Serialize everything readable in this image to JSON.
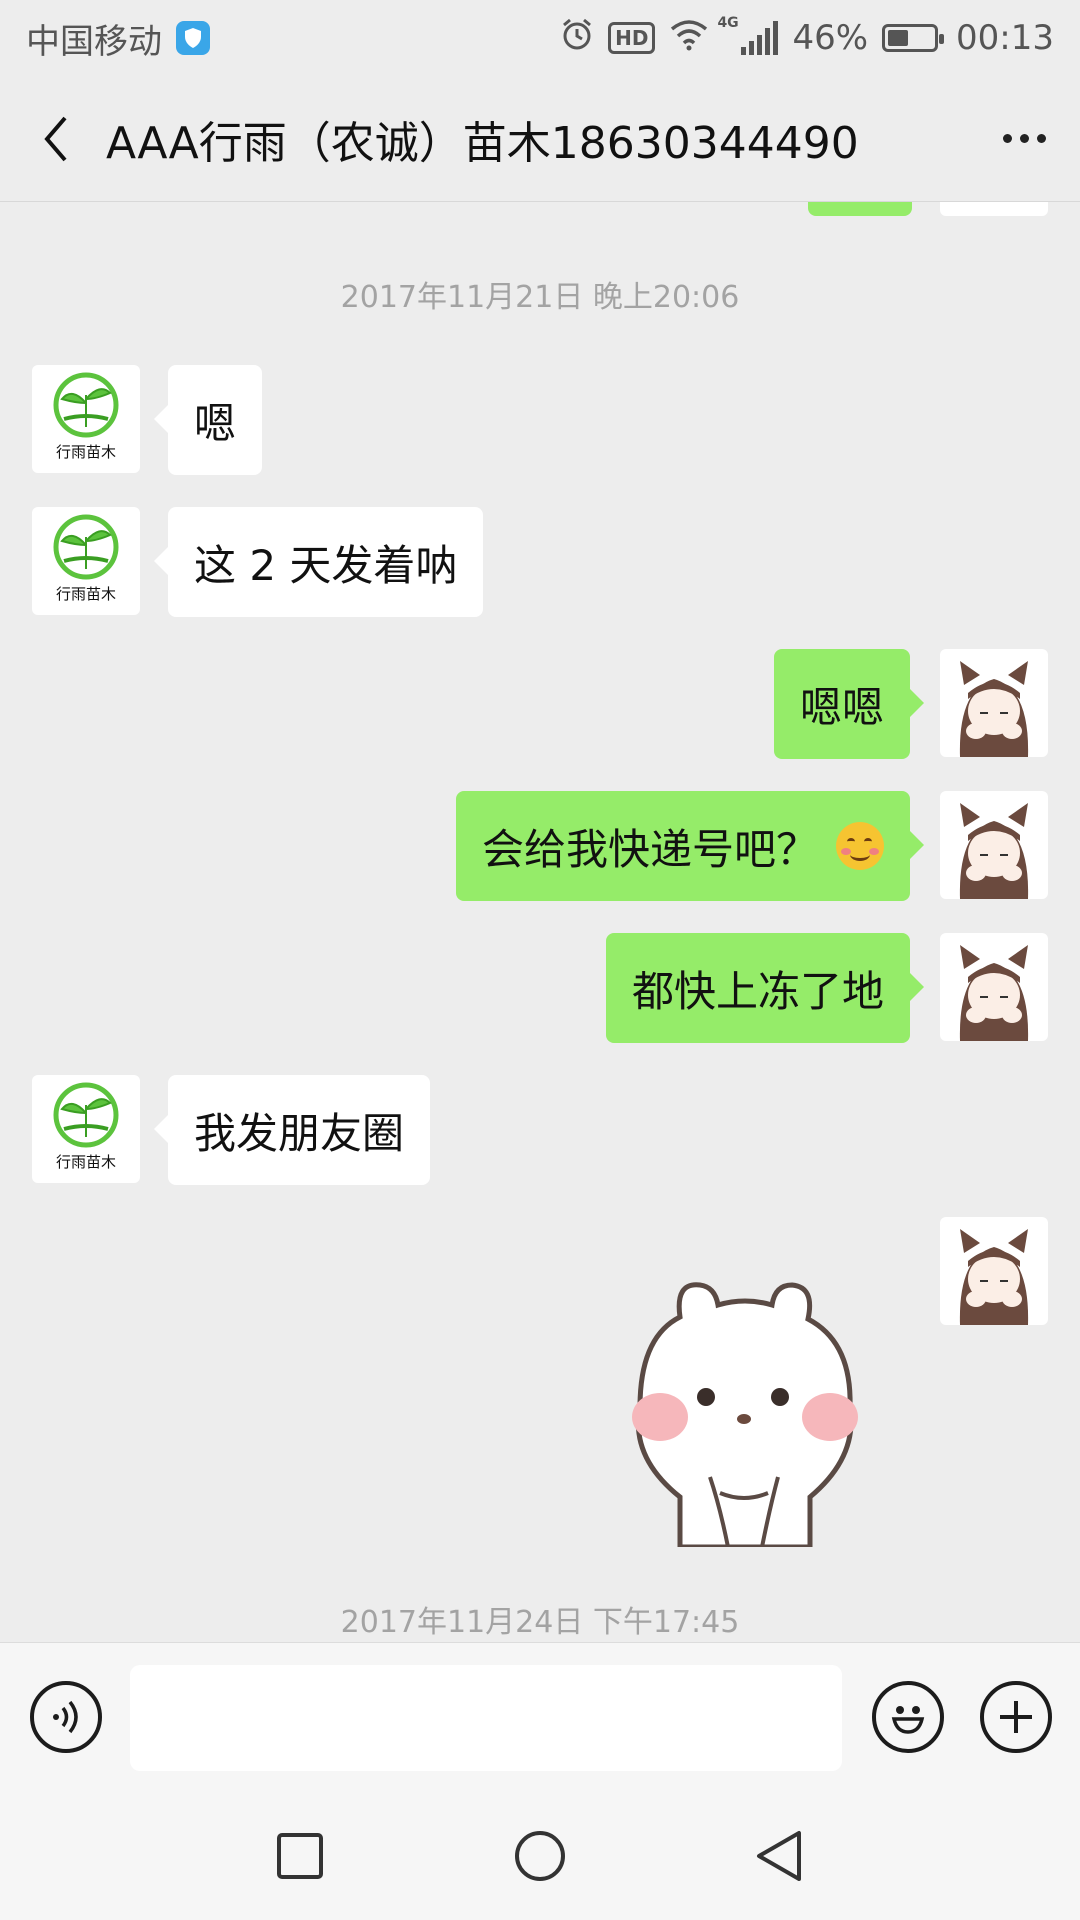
{
  "status_bar": {
    "carrier": "中国移动",
    "network": "4G",
    "hd": "HD",
    "battery_percent": "46%",
    "battery_level": 0.46,
    "time": "00:13"
  },
  "header": {
    "title": "AAA行雨（农诚）苗木18630344490"
  },
  "chat": {
    "timestamp_1": "2017年11月21日 晚上20:06",
    "timestamp_2": "2017年11月24日 下午17:45",
    "messages": [
      {
        "sender": "contact",
        "text": "嗯"
      },
      {
        "sender": "contact",
        "text": "这 2 天发着呐"
      },
      {
        "sender": "me",
        "text": "嗯嗯"
      },
      {
        "sender": "me",
        "text": "会给我快递号吧？",
        "emoji": "smiling-face-icon"
      },
      {
        "sender": "me",
        "text": "都快上冻了地"
      },
      {
        "sender": "contact",
        "text": "我发朋友圈"
      },
      {
        "sender": "me",
        "sticker": "bear-sticker"
      }
    ]
  },
  "input_bar": {
    "placeholder": "",
    "voice_icon": "voice-icon",
    "emoji_icon": "emoji-icon",
    "plus_icon": "plus-icon"
  },
  "colors": {
    "background": "#ededed",
    "outgoing_bubble": "#95ec69",
    "incoming_bubble": "#ffffff",
    "avatar_green": "#5cc33d"
  },
  "avatar_logo_text": "行雨苗木"
}
